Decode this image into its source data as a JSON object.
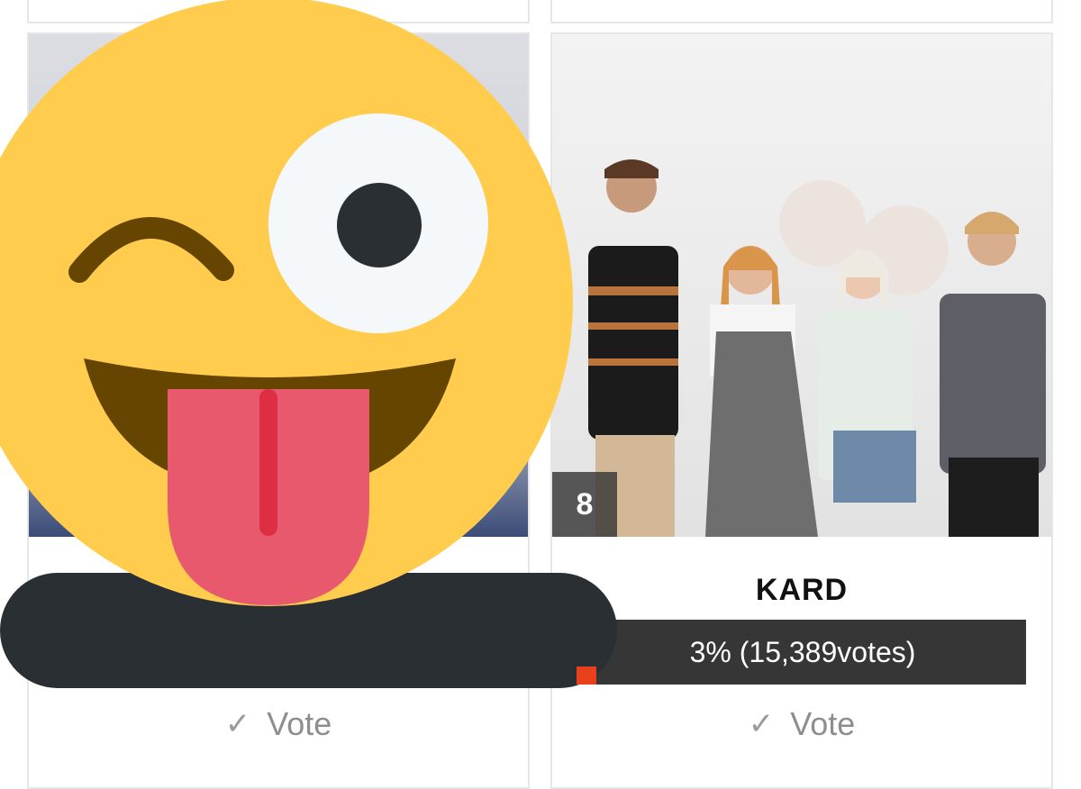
{
  "cards": [
    {
      "rank": "",
      "name": "",
      "result": "",
      "vote_label": "Vote"
    },
    {
      "rank": "8",
      "name": "KARD",
      "result": "3% (15,389votes)",
      "vote_share": 0.03,
      "vote_label": "Vote"
    }
  ],
  "icons": {
    "check": "check-icon",
    "emoji": "winking-face-with-tongue-emoji"
  },
  "colors": {
    "vote_bar": "#363636",
    "vote_fill": "#e8401c",
    "emoji_face": "#FFCC4D",
    "censor_bar": "#292F33"
  }
}
